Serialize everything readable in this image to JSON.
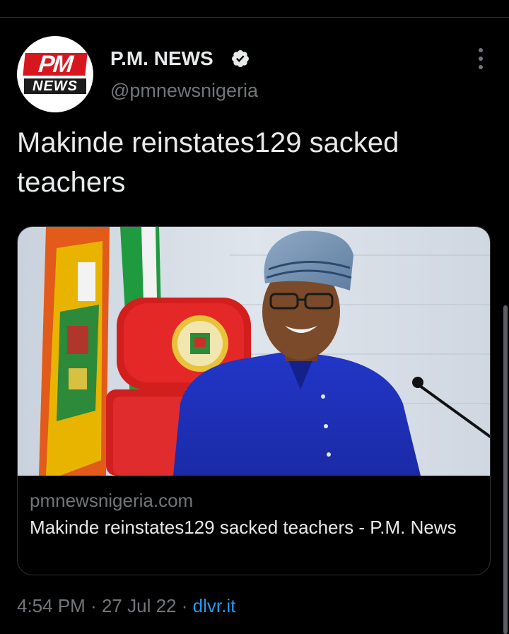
{
  "tweet": {
    "author_name": "P.M. NEWS",
    "author_handle": "@pmnewsnigeria",
    "avatar_logo_top": "PM",
    "avatar_logo_bottom": "NEWS",
    "verified": true,
    "text": "Makinde reinstates129 sacked teachers",
    "timestamp_time": "4:54 PM",
    "timestamp_date": "27 Jul 22",
    "source": "dlvr.it",
    "separator": "·"
  },
  "link_card": {
    "domain": "pmnewsnigeria.com",
    "title": "Makinde reinstates129 sacked teachers - P.M. News",
    "image_alt": "Man in blue agbada and striped cap seated in front of red chair with state emblem, flags and a microphone"
  },
  "icons": {
    "verified": "verified-badge-icon",
    "more": "more-options-icon"
  },
  "colors": {
    "background": "#000000",
    "text_primary": "#e7e9ea",
    "text_secondary": "#71767b",
    "link": "#1d9bf0",
    "border": "#2f3336",
    "logo_red": "#d7171f"
  }
}
